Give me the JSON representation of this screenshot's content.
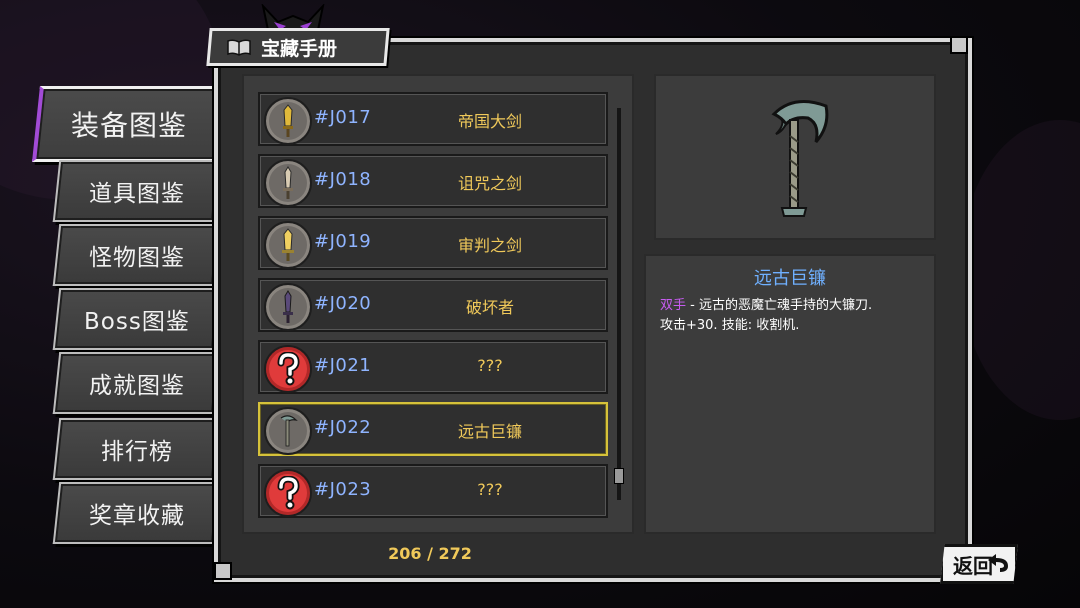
{
  "header": {
    "title": "宝藏手册",
    "book_icon": "book-icon"
  },
  "tabs": [
    {
      "label": "装备图鉴",
      "active": true
    },
    {
      "label": "道具图鉴",
      "active": false
    },
    {
      "label": "怪物图鉴",
      "active": false
    },
    {
      "label": "Boss图鉴",
      "active": false
    },
    {
      "label": "成就图鉴",
      "active": false
    },
    {
      "label": "排行榜",
      "active": false
    },
    {
      "label": "奖章收藏",
      "active": false
    }
  ],
  "list": {
    "items": [
      {
        "code": "#J017",
        "name": "帝国大剑",
        "icon": "golden-sword-icon",
        "known": true
      },
      {
        "code": "#J018",
        "name": "诅咒之剑",
        "icon": "bone-sword-icon",
        "known": true
      },
      {
        "code": "#J019",
        "name": "审判之剑",
        "icon": "judgment-sword-icon",
        "known": true
      },
      {
        "code": "#J020",
        "name": "破坏者",
        "icon": "purple-blade-icon",
        "known": true
      },
      {
        "code": "#J021",
        "name": "???",
        "icon": "question-mark-icon",
        "known": false
      },
      {
        "code": "#J022",
        "name": "远古巨镰",
        "icon": "scythe-icon",
        "known": true,
        "selected": true
      },
      {
        "code": "#J023",
        "name": "???",
        "icon": "question-mark-icon",
        "known": false
      }
    ],
    "counter": "206 / 272"
  },
  "detail": {
    "name": "远古巨镰",
    "tag": "双手",
    "desc_line1": " - 远古的恶魔亡魂手持的大镰刀.",
    "desc_line2": "攻击+30. 技能: 收割机.",
    "preview_icon": "scythe-icon"
  },
  "footer": {
    "back_label": "返回"
  },
  "colors": {
    "code": "#8fb4ff",
    "name": "#f0c95a",
    "detail_title": "#6fb0ff",
    "tag": "#c75cf0",
    "active_tab_accent": "#a24bd6",
    "selected_border": "#d6c23a"
  }
}
